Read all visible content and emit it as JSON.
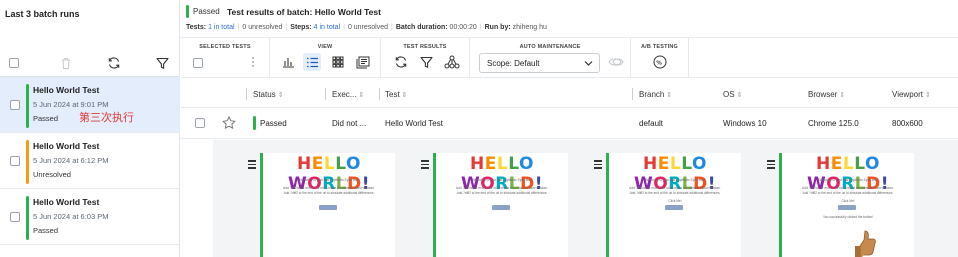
{
  "sidebar": {
    "title": "Last 3 batch runs",
    "runs": [
      {
        "name": "Hello World Test",
        "date": "5 Jun 2024 at 9:01 PM",
        "status": "Passed",
        "status_color": "#2bb24c",
        "note": "第三次执行"
      },
      {
        "name": "Hello World Test",
        "date": "5 Jun 2024 at 6:12 PM",
        "status": "Unresolved",
        "status_color": "#f39c12"
      },
      {
        "name": "Hello World Test",
        "date": "5 Jun 2024 at 6:03 PM",
        "status": "Passed",
        "status_color": "#2bb24c"
      }
    ]
  },
  "header": {
    "status": "Passed",
    "title": "Test results of batch:  Hello World Test",
    "tests_label": "Tests:",
    "tests_value": "1 in total",
    "tests_unresolved": "0 unresolved",
    "steps_label": "Steps:",
    "steps_value": "4 in total",
    "steps_unresolved": "0 unresolved",
    "duration_label": "Batch duration:",
    "duration_value": "00:00:20",
    "runby_label": "Run by:",
    "runby_value": "zhiheng hu"
  },
  "toolbar": {
    "groups": {
      "selected_tests": "SELECTED TESTS",
      "view": "VIEW",
      "test_results": "TEST RESULTS",
      "auto_maintenance": "AUTO MAINTENANCE",
      "ab_testing": "A/B TESTING"
    },
    "scope_value": "Scope: Default"
  },
  "grid": {
    "columns": [
      "Status",
      "Exec...",
      "Test",
      "Branch",
      "OS",
      "Browser",
      "Viewport"
    ],
    "row": {
      "status": "Passed",
      "exec": "Did not ...",
      "test": "Hello World Test",
      "branch": "default",
      "os": "Windows 10",
      "browser": "Chrome 125.0",
      "viewport": "800x600"
    }
  },
  "thumbnails": {
    "heading": "HELLO WORLD!",
    "line1": "Welcome to your first Applitools Eyes test!",
    "line2": "Add ?diff to the end of the url to make the number below random.",
    "line3": "Add ?diff2 to the end of the url to simulate additional differences.",
    "button": "Click Me!",
    "success": "You successfully clicked the button!"
  },
  "colors": {
    "accent": "#2f6fd6",
    "passed": "#2bb24c",
    "unresolved": "#f39c12",
    "selected_bg": "#e3edfb"
  }
}
